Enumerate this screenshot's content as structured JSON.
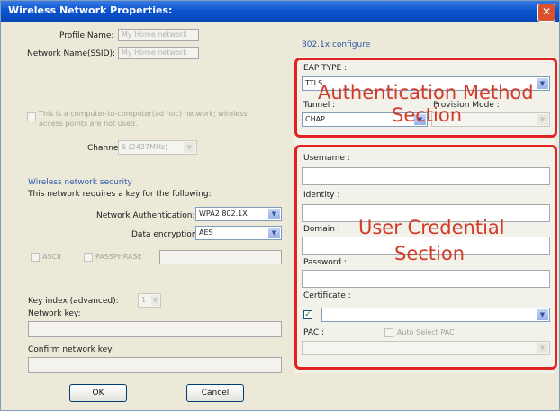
{
  "window": {
    "title": "Wireless Network Properties:",
    "close_glyph": "✕"
  },
  "left": {
    "profile_label": "Profile Name:",
    "profile_value": "My Home network",
    "ssid_label": "Network Name(SSID):",
    "ssid_value": "My Home network",
    "adhoc_text_1": "This is a computer-to-computer(ad hoc) network; wireless",
    "adhoc_text_2": "access points are not used.",
    "channel_label": "Channel:",
    "channel_value": "6 (2437MHz)",
    "security_heading": "Wireless network security",
    "requires_text": "This network requires a key for the following:",
    "auth_label": "Network Authentication:",
    "auth_value": "WPA2 802.1X",
    "enc_label": "Data encryption:",
    "enc_value": "AES",
    "ascii_label": "ASCII",
    "passphrase_label": "PASSPHRASE",
    "key_index_label": "Key index (advanced):",
    "key_index_value": "1",
    "network_key_label": "Network key:",
    "confirm_key_label": "Confirm network key:"
  },
  "buttons": {
    "ok": "OK",
    "cancel": "Cancel"
  },
  "right": {
    "link": "802.1x configure",
    "eap_type_label": "EAP TYPE :",
    "eap_type_value": "TTLS",
    "tunnel_label": "Tunnel :",
    "provision_label": "Provision Mode :",
    "tunnel_value": "CHAP",
    "username_label": "Username :",
    "identity_label": "Identity :",
    "domain_label": "Domain :",
    "password_label": "Password :",
    "certificate_label": "Certificate :",
    "pac_label": "PAC :",
    "auto_select_pac_label": "Auto Select PAC"
  },
  "annotations": {
    "auth_line1": "Authentication Method",
    "auth_line2": "Section",
    "cred_line1": "User Credential",
    "cred_line2": "Section"
  },
  "colors": {
    "annotation": "#d23a2a",
    "highlight_box": "#e02424",
    "titlebar": "#0a55cf"
  },
  "icons": {
    "close": "close-icon",
    "dropdown": "chevron-down-icon",
    "checkbox_checked": "check-icon"
  }
}
